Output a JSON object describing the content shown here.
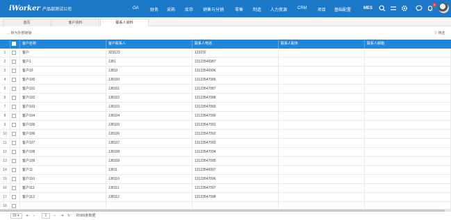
{
  "app": {
    "logo": "iWorker",
    "company": "产品部测试公司"
  },
  "nav": [
    "OA",
    "财务",
    "采购",
    "库存",
    "销售与分销",
    "零售",
    "制造",
    "人力资源",
    "CRM",
    "项目",
    "基础配置"
  ],
  "mes": "MES",
  "notification_count": "1",
  "tabs": [
    {
      "label": "首页",
      "active": false
    },
    {
      "label": "客户资料",
      "active": false
    },
    {
      "label": "联系人资料",
      "active": true
    }
  ],
  "toolbar": {
    "export_label": "转为外部链接",
    "filter_label": "筛选"
  },
  "columns": [
    "客户名称",
    "客户联系人",
    "联系人电话",
    "联系人职务",
    "联系人邮箱"
  ],
  "rows": [
    {
      "n": "1",
      "name": "客户",
      "contact": "323123",
      "phone": "123232"
    },
    {
      "n": "2",
      "name": "客户1",
      "contact": "JJ81",
      "phone": "13123546987"
    },
    {
      "n": "3",
      "name": "客户10",
      "contact": "JJ810",
      "phone": "13123546996"
    },
    {
      "n": "4",
      "name": "客户100",
      "contact": "JJ8100",
      "phone": "13123547086"
    },
    {
      "n": "5",
      "name": "客户101",
      "contact": "JJ8101",
      "phone": "13123547087"
    },
    {
      "n": "6",
      "name": "客户102",
      "contact": "JJ8102",
      "phone": "13123547088"
    },
    {
      "n": "7",
      "name": "客户103",
      "contact": "JJ8103",
      "phone": "13123547089"
    },
    {
      "n": "8",
      "name": "客户104",
      "contact": "JJ8104",
      "phone": "13123547090"
    },
    {
      "n": "9",
      "name": "客户105",
      "contact": "JJ8105",
      "phone": "13123547091"
    },
    {
      "n": "10",
      "name": "客户106",
      "contact": "JJ8106",
      "phone": "13123547092"
    },
    {
      "n": "11",
      "name": "客户107",
      "contact": "JJ8107",
      "phone": "13123547093"
    },
    {
      "n": "12",
      "name": "客户108",
      "contact": "JJ8108",
      "phone": "13123547094"
    },
    {
      "n": "13",
      "name": "客户109",
      "contact": "JJ8109",
      "phone": "13123547095"
    },
    {
      "n": "14",
      "name": "客户11",
      "contact": "JJ811",
      "phone": "13123546997"
    },
    {
      "n": "15",
      "name": "客户110",
      "contact": "JJ8110",
      "phone": "13123547096"
    },
    {
      "n": "16",
      "name": "客户111",
      "contact": "JJ8111",
      "phone": "13123547097"
    },
    {
      "n": "17",
      "name": "客户112",
      "contact": "JJ8112",
      "phone": "13123547098"
    },
    {
      "n": "18",
      "name": "",
      "contact": "",
      "phone": ""
    }
  ],
  "pager": {
    "page_size": "20",
    "page": "1",
    "total": "共589条数据"
  }
}
